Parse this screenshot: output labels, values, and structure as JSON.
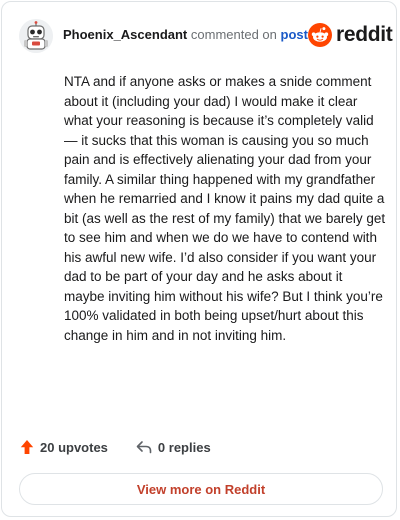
{
  "header": {
    "username": "Phoenix_Ascendant",
    "action_text": "commented on",
    "post_link_label": "post",
    "brand_wordmark": "reddit",
    "brand_icon": "reddit-alien-icon",
    "avatar_icon": "robot-avatar-icon"
  },
  "comment": {
    "body": "NTA and if anyone asks or makes a snide comment about it (including your dad) I would make it clear what your reasoning is because it’s completely valid— it sucks that this woman is causing you so much pain and is effectively alienating your dad from your family. A similar thing happened with my grandfather when he remarried and I know it pains my dad quite a bit (as well as the rest of my family) that we barely get to see him and when we do we have to contend with his awful new wife. I’d also consider if you want your dad to be part of your day and he asks about it maybe inviting him without his wife? But I think you’re 100% validated in both being upset/hurt about this change in him and in not inviting him."
  },
  "footer": {
    "upvotes_label": "20 upvotes",
    "replies_label": "0 replies",
    "upvote_icon": "upvote-arrow-icon",
    "reply_icon": "reply-arrow-icon"
  },
  "cta": {
    "view_more_label": "View more on Reddit"
  },
  "colors": {
    "brand": "#ff4500",
    "link": "#1a59c7",
    "cta_text": "#c2402b",
    "border": "#dfe3e6"
  }
}
